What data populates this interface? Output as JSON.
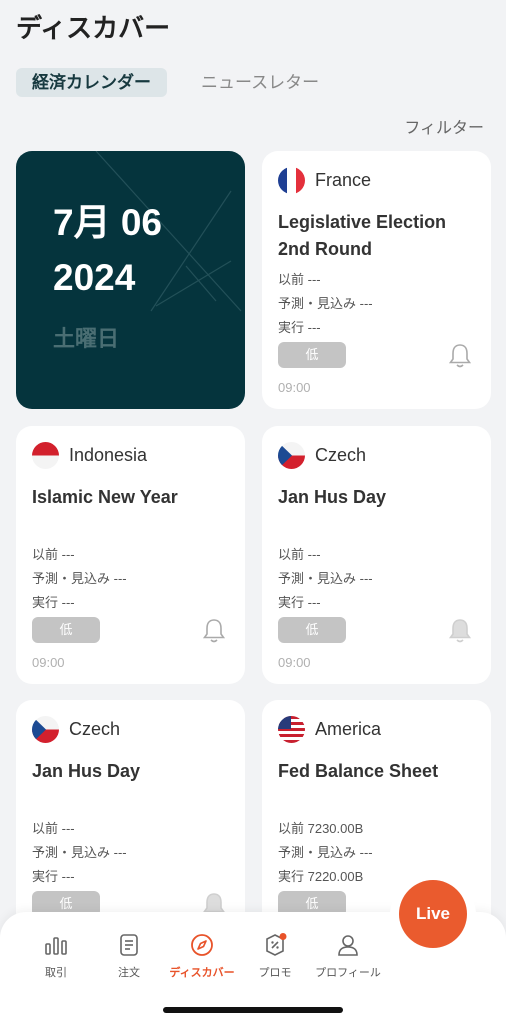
{
  "header": {
    "title": "ディスカバー"
  },
  "tabs": [
    {
      "label": "経済カレンダー",
      "active": true
    },
    {
      "label": "ニュースレター",
      "active": false
    }
  ],
  "filter_label": "フィルター",
  "date_card": {
    "line1": "7月 06",
    "line2": "2024",
    "weekday": "土曜日"
  },
  "events": [
    {
      "country": "France",
      "flag": "france-flag",
      "title": "Legislative Election 2nd Round",
      "previous": "以前 ---",
      "forecast": "予測・見込み ---",
      "actual": "実行 ---",
      "importance": "低",
      "time": "09:00",
      "bell": "bell-icon"
    },
    {
      "country": "Indonesia",
      "flag": "indonesia-flag",
      "title": "Islamic New Year",
      "previous": "以前 ---",
      "forecast": "予測・見込み ---",
      "actual": "実行 ---",
      "importance": "低",
      "time": "09:00",
      "bell": "bell-icon"
    },
    {
      "country": "Czech",
      "flag": "czech-flag",
      "title": "Jan Hus Day",
      "previous": "以前 ---",
      "forecast": "予測・見込み ---",
      "actual": "実行 ---",
      "importance": "低",
      "time": "09:00",
      "bell": "bell-icon"
    },
    {
      "country": "Czech",
      "flag": "czech-flag",
      "title": "Jan Hus Day",
      "previous": "以前 ---",
      "forecast": "予測・見込み ---",
      "actual": "実行 ---",
      "importance": "低",
      "bell": "bell-icon"
    },
    {
      "country": "America",
      "flag": "usa-flag",
      "title": "Fed Balance Sheet",
      "previous": "以前 7230.00B",
      "forecast": "予測・見込み ---",
      "actual": "実行 7220.00B",
      "importance": "低"
    }
  ],
  "nav": [
    {
      "label": "取引",
      "icon": "bar-chart-icon"
    },
    {
      "label": "注文",
      "icon": "document-icon"
    },
    {
      "label": "ディスカバー",
      "icon": "compass-icon",
      "active": true
    },
    {
      "label": "プロモ",
      "icon": "coupon-icon"
    },
    {
      "label": "プロフィール",
      "icon": "person-icon"
    }
  ],
  "live_label": "Live",
  "colors": {
    "accent": "#ea5b2e",
    "date_card": "#05343d",
    "importance_badge": "#c4c4c4"
  }
}
